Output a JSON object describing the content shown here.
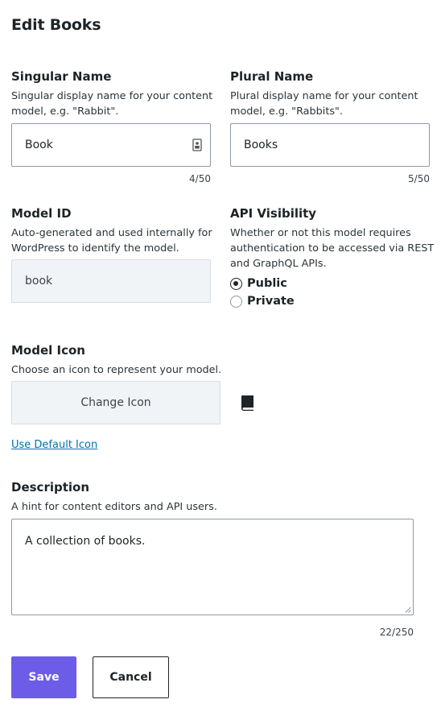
{
  "page": {
    "title": "Edit Books"
  },
  "singular": {
    "label": "Singular Name",
    "help": "Singular display name for your content model, e.g. \"Rabbit\".",
    "value": "Book",
    "counter": "4/50",
    "icon": "id-card-icon"
  },
  "plural": {
    "label": "Plural Name",
    "help": "Plural display name for your content model, e.g. \"Rabbits\".",
    "value": "Books",
    "counter": "5/50"
  },
  "model_id": {
    "label": "Model ID",
    "help": "Auto-generated and used internally for WordPress to identify the model.",
    "value": "book"
  },
  "api_visibility": {
    "label": "API Visibility",
    "help": "Whether or not this model requires authentication to be accessed via REST and GraphQL APIs.",
    "options": [
      {
        "label": "Public",
        "checked": true
      },
      {
        "label": "Private",
        "checked": false
      }
    ]
  },
  "model_icon": {
    "label": "Model Icon",
    "help": "Choose an icon to represent your model.",
    "button_label": "Change Icon",
    "current_icon": "book-icon",
    "default_link": "Use Default Icon"
  },
  "description": {
    "label": "Description",
    "help": "A hint for content editors and API users.",
    "value": "A collection of books.",
    "counter": "22/250"
  },
  "actions": {
    "save": "Save",
    "cancel": "Cancel"
  },
  "colors": {
    "primary": "#6c5ce7",
    "link": "#0073aa"
  }
}
